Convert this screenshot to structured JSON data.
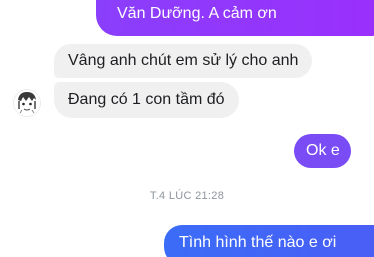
{
  "conversation": {
    "messages": [
      {
        "direction": "outgoing",
        "text": "Văn Dưỡng. A cảm ơn"
      },
      {
        "direction": "incoming",
        "text": "Vâng anh chút em sử lý cho anh"
      },
      {
        "direction": "incoming",
        "text": "Đang có 1 con tầm đó"
      },
      {
        "direction": "outgoing",
        "text": "Ok e"
      },
      {
        "direction": "outgoing",
        "text": "Tình hình thế nào e ơi"
      }
    ],
    "timestamp": "T.4 LÚC 21:28"
  },
  "colors": {
    "outgoing_purple": "#8a3ffc",
    "outgoing_violet": "#7a4cf5",
    "outgoing_blue": "#3b6cf7",
    "incoming_bubble": "#f1f0f0",
    "timestamp_text": "#8d949e"
  },
  "icons": {
    "sender_avatar": "cartoon-face-avatar-icon"
  }
}
